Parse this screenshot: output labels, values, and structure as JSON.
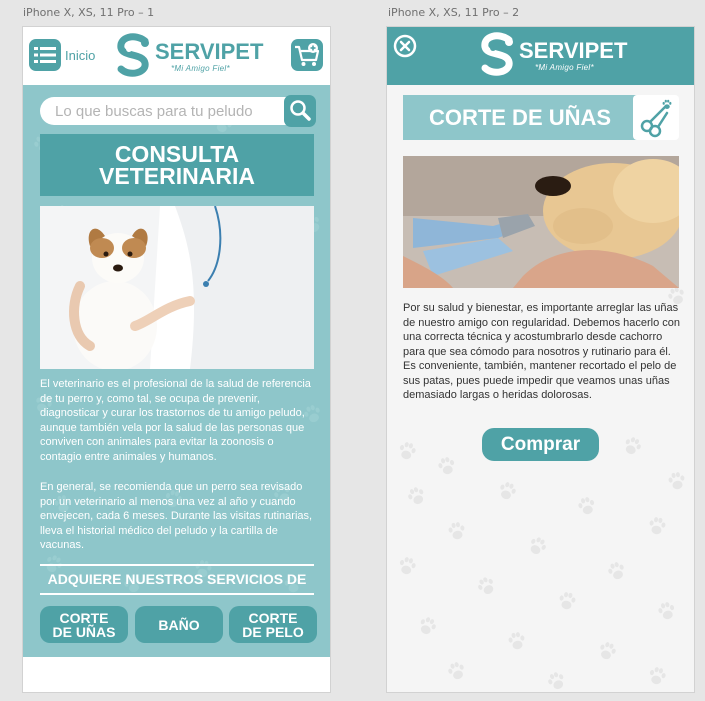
{
  "frames": [
    {
      "title": "iPhone X, XS, 11 Pro – 1",
      "header": {
        "menu_label": "Inicio",
        "brand": "SERVIPET",
        "tagline": "*Mi Amigo Fiel*"
      },
      "search": {
        "placeholder": "Lo que buscas para tu peludo"
      },
      "banner": {
        "line1": "CONSULTA",
        "line2": "VETERINARIA"
      },
      "paragraphs": [
        "El veterinario es el profesional de la salud de referencia de tu perro y, como tal, se ocupa de prevenir, diagnosticar y curar los trastornos de tu amigo peludo, aunque también vela por la salud de las personas que conviven con animales para evitar la zoonosis o contagio entre animales y humanos.",
        "En general, se recomienda que un perro sea revisado por un veterinario al menos una vez al año y cuando envejecen, cada 6 meses. Durante las visitas rutinarias, lleva el historial médico del peludo y la cartilla de vacunas."
      ],
      "services": {
        "title": "ADQUIERE NUESTROS SERVICIOS DE",
        "buttons": [
          {
            "line1": "CORTE",
            "line2": "DE UÑAS"
          },
          {
            "line1": "BAÑO",
            "line2": ""
          },
          {
            "line1": "CORTE",
            "line2": "DE PELO"
          }
        ]
      }
    },
    {
      "title": "iPhone X, XS, 11 Pro – 2",
      "header": {
        "brand": "SERVIPET",
        "tagline": "*Mi Amigo Fiel*"
      },
      "page_title": "CORTE DE UÑAS",
      "paragraph": "Por su salud y bienestar, es importante arreglar las uñas de nuestro amigo con regularidad. Debemos hacerlo con una correcta técnica y acostumbrarlo desde cachorro para que sea cómodo para nosotros y rutinario para él. Es conveniente, también, mantener recortado el pelo de sus patas, pues puede impedir que veamos unas uñas demasiado largas o heridas dolorosas.",
      "buy_label": "Comprar"
    }
  ],
  "colors": {
    "teal": "#4fa2a6",
    "light_teal": "#8ec6ca",
    "canvas": "#e6e6e6"
  },
  "icons": [
    "menu-icon",
    "cart-icon",
    "search-icon",
    "close-icon",
    "scissors-icon",
    "paw-icon"
  ]
}
